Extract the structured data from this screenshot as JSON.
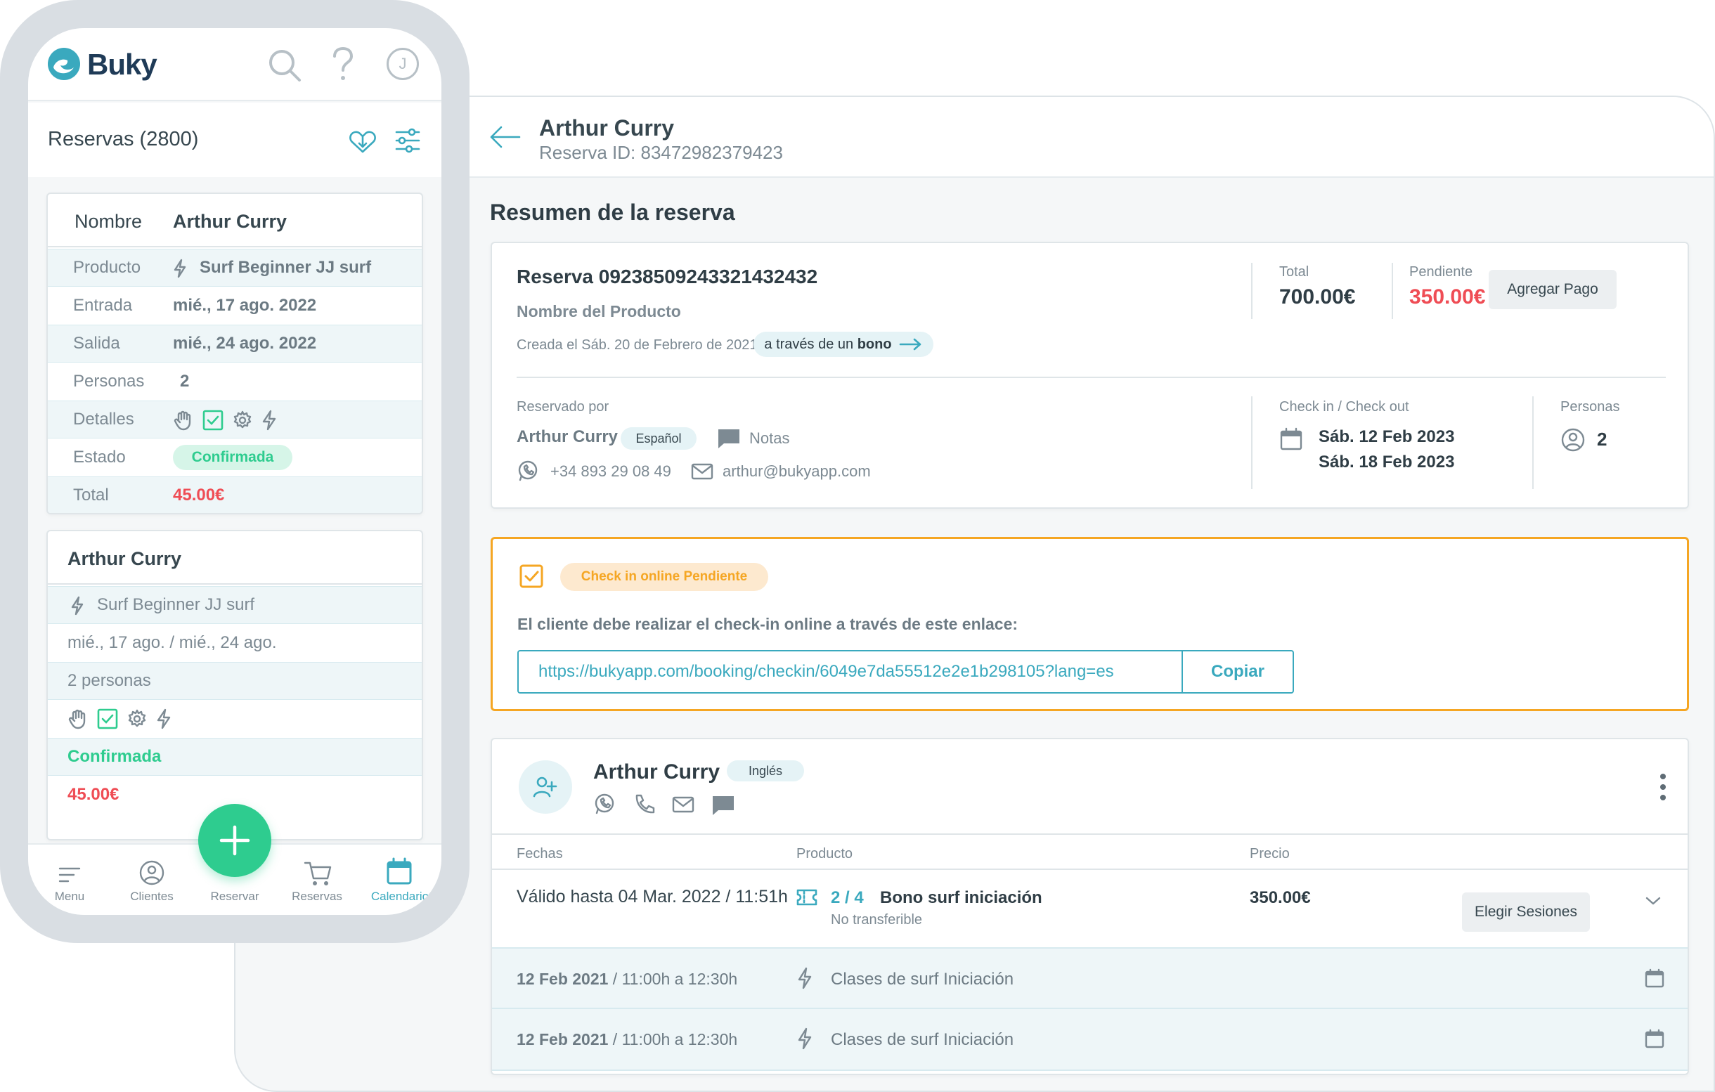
{
  "phone": {
    "brand": "Buky",
    "title": "Reservas (2800)",
    "avatar_initial": "J",
    "card1": {
      "header_label": "Nombre",
      "header_value": "Arthur Curry",
      "rows": [
        {
          "label": "Producto",
          "value": "Surf Beginner JJ surf"
        },
        {
          "label": "Entrada",
          "value": "mié., 17 ago. 2022"
        },
        {
          "label": "Salida",
          "value": "mié., 24 ago. 2022"
        },
        {
          "label": "Personas",
          "value": "2"
        },
        {
          "label": "Detalles",
          "value": ""
        },
        {
          "label": "Estado",
          "value": "Confirmada"
        },
        {
          "label": "Total",
          "value": "45.00€"
        }
      ]
    },
    "card2": {
      "name": "Arthur Curry",
      "product": "Surf Beginner JJ surf",
      "dates": "mié., 17 ago. / mié., 24 ago.",
      "persons": "2 personas",
      "status": "Confirmada",
      "total": "45.00€"
    },
    "tabbar": [
      {
        "label": "Menu",
        "icon": "menu-icon"
      },
      {
        "label": "Clientes",
        "icon": "user-circle-icon"
      },
      {
        "label": "Reservar",
        "icon": "plus-icon"
      },
      {
        "label": "Reservas",
        "icon": "cart-icon"
      },
      {
        "label": "Calendario",
        "icon": "calendar-icon",
        "active": true
      }
    ]
  },
  "desktop": {
    "header": {
      "name": "Arthur Curry",
      "reservation_id": "Reserva ID: 83472982379423"
    },
    "section_title": "Resumen de la reserva",
    "summary": {
      "reservation": "Reserva 09238509243321432432",
      "product": "Nombre del Producto",
      "created": "Creada el Sáb. 20 de Febrero de 2021",
      "via_prefix": "a través de un ",
      "via_strong": "bono",
      "total_label": "Total",
      "total_value": "700.00€",
      "pending_label": "Pendiente",
      "pending_value": "350.00€",
      "add_payment": "Agregar Pago",
      "booked_by_label": "Reservado por",
      "booked_by_name": "Arthur Curry",
      "language": "Español",
      "notes": "Notas",
      "phone": "+34 893 29 08 49",
      "email": "arthur@bukyapp.com",
      "checkin_label": "Check in / Check out",
      "checkin": "Sáb. 12 Feb 2023",
      "checkout": "Sáb. 18 Feb 2023",
      "persons_label": "Personas",
      "persons": "2"
    },
    "checkin_online": {
      "badge": "Check in online Pendiente",
      "text": "El cliente debe realizar el check-in online a través de este enlace:",
      "url": "https://bukyapp.com/booking/checkin/6049e7da55512e2e1b298105?lang=es",
      "copy": "Copiar"
    },
    "client": {
      "name": "Arthur Curry",
      "language": "Inglés",
      "columns": [
        "Fechas",
        "Producto",
        "Precio"
      ],
      "valid_until": "Válido hasta 04 Mar. 2022 / 11:51h",
      "sessions": "2 / 4",
      "product": "Bono surf iniciación",
      "transfer": "No transferible",
      "price": "350.00€",
      "choose_sessions": "Elegir Sesiones",
      "session_rows": [
        {
          "date": "12 Feb 2021",
          "time": " / 11:00h a 12:30h",
          "name": "Clases de surf Iniciación"
        },
        {
          "date": "12 Feb 2021",
          "time": " / 11:00h a 12:30h",
          "name": "Clases de surf Iniciación"
        }
      ]
    }
  },
  "colors": {
    "teal": "#3aa9be",
    "green": "#2ecc8f",
    "red": "#ef4d55",
    "orange": "#f5a623",
    "brand_dark": "#1f3b57"
  }
}
